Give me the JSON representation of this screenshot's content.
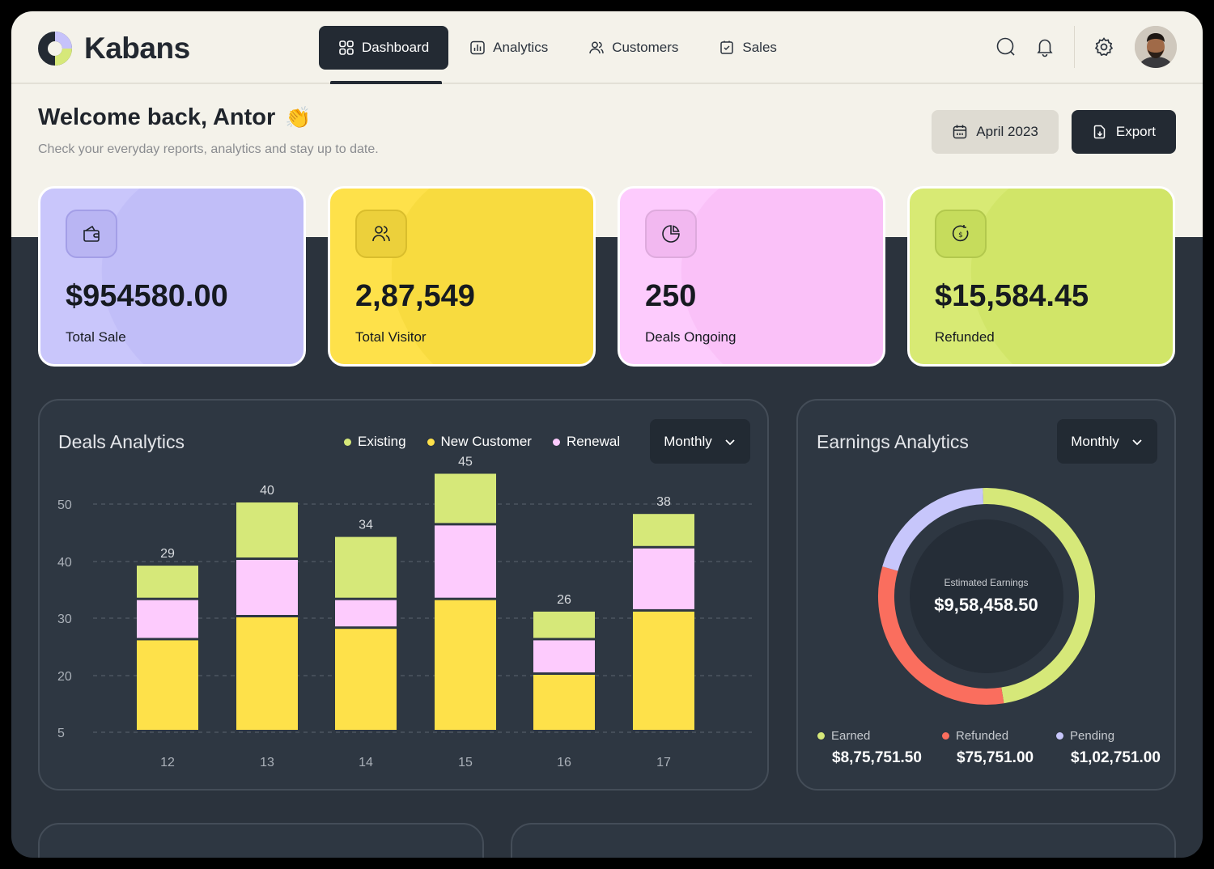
{
  "app": {
    "name": "Kabans"
  },
  "nav": {
    "items": [
      {
        "label": "Dashboard",
        "icon": "grid-icon",
        "active": true
      },
      {
        "label": "Analytics",
        "icon": "analytics-icon",
        "active": false
      },
      {
        "label": "Customers",
        "icon": "users-icon",
        "active": false
      },
      {
        "label": "Sales",
        "icon": "receipt-icon",
        "active": false
      }
    ]
  },
  "header": {
    "greeting": "Welcome back, Antor",
    "emoji": "👏",
    "subtitle": "Check your everyday reports, analytics and stay up to date.",
    "date_button": "April 2023",
    "export_button": "Export"
  },
  "stats": [
    {
      "value": "$954580.00",
      "label": "Total Sale",
      "color": "#c9c6fb",
      "icon": "wallet-icon"
    },
    {
      "value": "2,87,549",
      "label": "Total Visitor",
      "color": "#fee14a",
      "icon": "users-icon"
    },
    {
      "value": "250",
      "label": "Deals Ongoing",
      "color": "#fdcbfd",
      "icon": "pie-icon"
    },
    {
      "value": "$15,584.45",
      "label": "Refunded",
      "color": "#d8ea74",
      "icon": "refund-icon"
    }
  ],
  "deals": {
    "title": "Deals Analytics",
    "dropdown": "Monthly",
    "legend": [
      {
        "name": "Existing",
        "color": "#d6e879"
      },
      {
        "name": "New Customer",
        "color": "#fee14a"
      },
      {
        "name": "Renewal",
        "color": "#fdcbfd"
      }
    ]
  },
  "earnings": {
    "title": "Earnings Analytics",
    "dropdown": "Monthly",
    "center_label": "Estimated Earnings",
    "center_value": "$9,58,458.50",
    "legend": [
      {
        "name": "Earned",
        "value": "$8,75,751.50",
        "color": "#d6e879"
      },
      {
        "name": "Refunded",
        "value": "$75,751.00",
        "color": "#fa6e5e"
      },
      {
        "name": "Pending",
        "value": "$1,02,751.00",
        "color": "#c7c6fb"
      }
    ]
  },
  "chart_data": [
    {
      "type": "bar",
      "stacked": true,
      "categories": [
        "12",
        "13",
        "14",
        "15",
        "16",
        "17"
      ],
      "series": [
        {
          "name": "New Customer",
          "values": [
            16,
            20,
            18,
            23,
            10,
            21
          ],
          "color": "#fee14a"
        },
        {
          "name": "Renewal",
          "values": [
            7,
            10,
            5,
            13,
            6,
            11
          ],
          "color": "#fdcbfd"
        },
        {
          "name": "Existing",
          "values": [
            6,
            10,
            11,
            9,
            5,
            6
          ],
          "color": "#d6e879"
        }
      ],
      "totals": [
        29,
        40,
        34,
        45,
        26,
        38
      ],
      "y_ticks": [
        5,
        20,
        30,
        40,
        50
      ],
      "grid": true
    },
    {
      "type": "pie",
      "donut": true,
      "labels": [
        "Earned",
        "Refunded",
        "Pending"
      ],
      "values": [
        875751.5,
        75751.0,
        102751.0
      ],
      "arc_fractions": [
        0.48,
        0.32,
        0.2
      ],
      "colors": [
        "#d6e879",
        "#fa6e5e",
        "#c7c6fb"
      ]
    }
  ]
}
